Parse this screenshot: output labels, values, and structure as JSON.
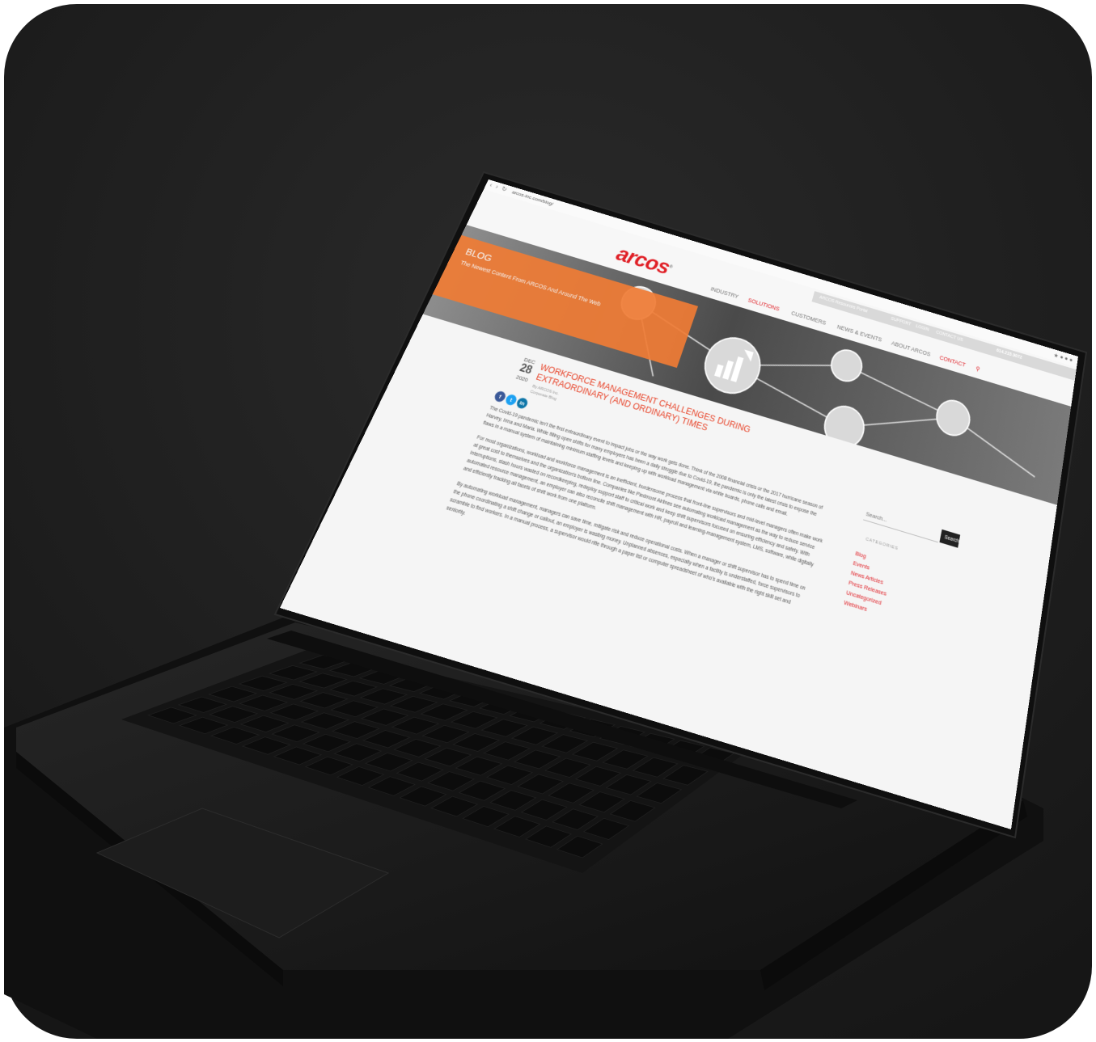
{
  "browser": {
    "url": "arcos-inc.com/blog/"
  },
  "header": {
    "logo": "arcos",
    "topbar": {
      "link1": "ARCOS Resources Portal",
      "link2": "SUPPORT",
      "link3": "LOGIN",
      "link4": "CONTACT US",
      "phone": "614.215.9072"
    },
    "menu": [
      "INDUSTRY",
      "SOLUTIONS",
      "CUSTOMERS",
      "NEWS & EVENTS",
      "ABOUT ARCOS",
      "CONTACT"
    ]
  },
  "hero": {
    "title": "BLOG",
    "subtitle": "The Newest Content From ARCOS And Around The Web"
  },
  "post": {
    "month": "DEC",
    "day": "28",
    "year": "2020",
    "title": "WORKFORCE MANAGEMENT CHALLENGES DURING EXTRAORDINARY (AND ORDINARY) TIMES",
    "byline": "By ARCOS Inc.",
    "category": "Corporate Blog",
    "share": [
      "f",
      "t",
      "in"
    ],
    "paragraphs": [
      "The Covid-19 pandemic isn't the first extraordinary event to impact jobs or the way work gets done. Think of the 2008 financial crisis or the 2017 hurricane season of Harvey, Irma and Maria. While filling open shifts for many employers has been a daily struggle due to Covid-19, the pandemic is only the latest crisis to expose the flaws in a manual system of maintaining minimum staffing levels and keeping up with workload management via white boards, phone calls and email.",
      "For most organizations, workload and workforce management is an inefficient, burdensome process that front-line supervisors and mid-level managers often make work at great cost to themselves and the organization's bottom line. Companies like Piedmont Airlines see automating workload management as the way to reduce service interruptions, slash hours wasted on recordkeeping, redeploy support staff to critical work and keep shift supervisors focused on ensuring efficiency and safety. With automated resource management, an employer can also reconcile shift management with HR, payroll and learning-management system, LMS, software, while digitally and efficiently tracking all facets of shift work from one platform.",
      "By automating workload management, managers can save time, mitigate risk and reduce operational costs. When a manager or shift supervisor has to spend time on the phone coordinating a shift change or callout, an employer is wasting money. Unplanned absences, especially when a facility is understaffed, force supervisors to scramble to find workers. In a manual process, a supervisor would rifle through a paper list or computer spreadsheet of who's available with the right skill set and seniority."
    ]
  },
  "sidebar": {
    "search_placeholder": "Search...",
    "search_button": "Search",
    "categories_heading": "CATEGORIES",
    "categories": [
      "Blog",
      "Events",
      "News Articles",
      "Press Releases",
      "Uncategorized",
      "Webinars"
    ]
  },
  "colors": {
    "brand_red": "#e01f26",
    "hero_orange": "#f07c35",
    "laptop_body": "#1c1c1c",
    "background": "#222222"
  }
}
